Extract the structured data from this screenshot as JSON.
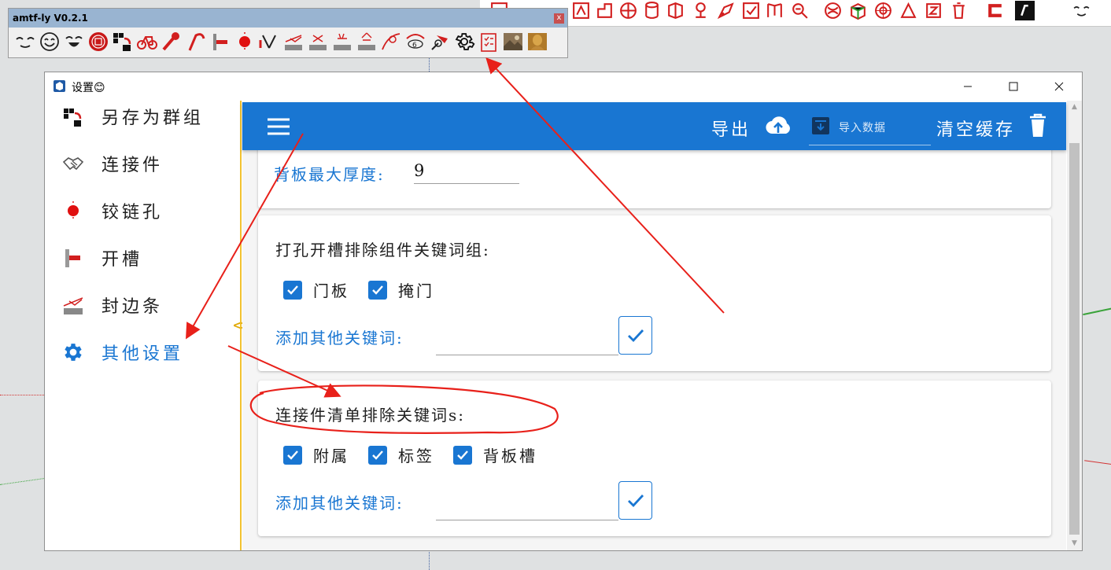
{
  "toolbar": {
    "title": "amtf-ly V0.2.1",
    "close_symbol": "x",
    "icons": [
      "face-icon",
      "smile-icon",
      "laugh-icon",
      "red-seal-icon",
      "group-save-icon",
      "bicycle-icon",
      "pin-icon",
      "hook-icon",
      "slot-icon",
      "hinge-hole-icon",
      "cut-icon",
      "edge-band-icon",
      "edge-band-cross-icon",
      "edge-band-light-icon",
      "edge-band-full-icon",
      "curve-icon",
      "counter-icon",
      "drill-icon",
      "gear-icon",
      "checklist-icon",
      "photo-icon",
      "buddha-icon"
    ]
  },
  "window": {
    "title": "设置😊",
    "controls": [
      "minimize",
      "maximize",
      "close"
    ]
  },
  "sidebar": {
    "items": [
      {
        "label": "另存为群组",
        "icon": "group-save-icon"
      },
      {
        "label": "连接件",
        "icon": "handshake-icon"
      },
      {
        "label": "铰链孔",
        "icon": "hinge-hole-icon"
      },
      {
        "label": "开槽",
        "icon": "slot-icon"
      },
      {
        "label": "封边条",
        "icon": "edge-band-icon"
      },
      {
        "label": "其他设置",
        "icon": "gear-icon",
        "active": true
      }
    ],
    "splitter_symbol": "<>"
  },
  "appbar": {
    "export_label": "导出",
    "import_placeholder": "导入数据",
    "clear_label": "清空缓存"
  },
  "panel1": {
    "label": "背板最大厚度:",
    "value": "9"
  },
  "panel2": {
    "title": "打孔开槽排除组件关键词组:",
    "checkboxes": [
      {
        "label": "门板",
        "checked": true
      },
      {
        "label": "掩门",
        "checked": true
      }
    ],
    "add_label": "添加其他关键词:",
    "add_value": ""
  },
  "panel3": {
    "title": "连接件清单排除关键词s:",
    "checkboxes": [
      {
        "label": "附属",
        "checked": true
      },
      {
        "label": "标签",
        "checked": true
      },
      {
        "label": "背板槽",
        "checked": true
      }
    ],
    "add_label": "添加其他关键词:",
    "add_value": ""
  },
  "colors": {
    "primary": "#1976d2",
    "annotation_red": "#e8201a"
  }
}
